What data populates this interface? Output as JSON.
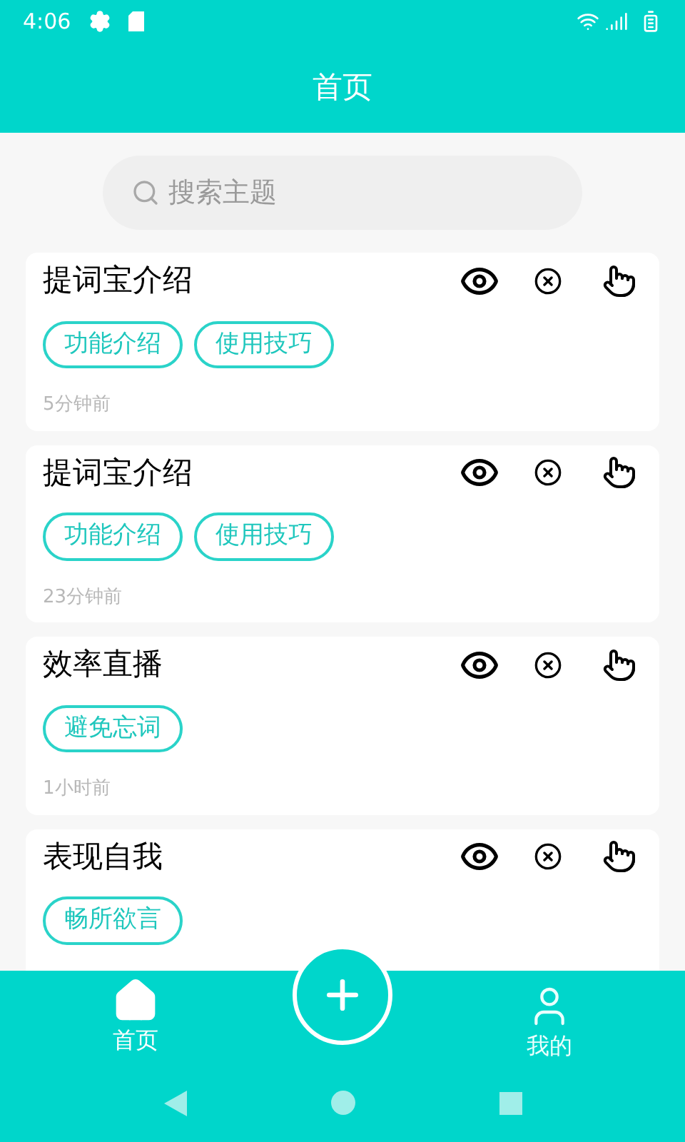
{
  "status_bar": {
    "time": "4:06"
  },
  "header": {
    "title": "首页"
  },
  "search": {
    "placeholder": "搜索主题"
  },
  "cards": [
    {
      "title": "提词宝介绍",
      "tags": [
        "功能介绍",
        "使用技巧"
      ],
      "time": "5分钟前"
    },
    {
      "title": "提词宝介绍",
      "tags": [
        "功能介绍",
        "使用技巧"
      ],
      "time": "23分钟前"
    },
    {
      "title": "效率直播",
      "tags": [
        "避免忘词"
      ],
      "time": "1小时前"
    },
    {
      "title": "表现自我",
      "tags": [
        "畅所欲言"
      ]
    }
  ],
  "bottom_nav": [
    {
      "label": "首页",
      "kind": "home",
      "selected": true
    },
    {
      "label": "我的",
      "kind": "profile",
      "selected": false
    }
  ]
}
